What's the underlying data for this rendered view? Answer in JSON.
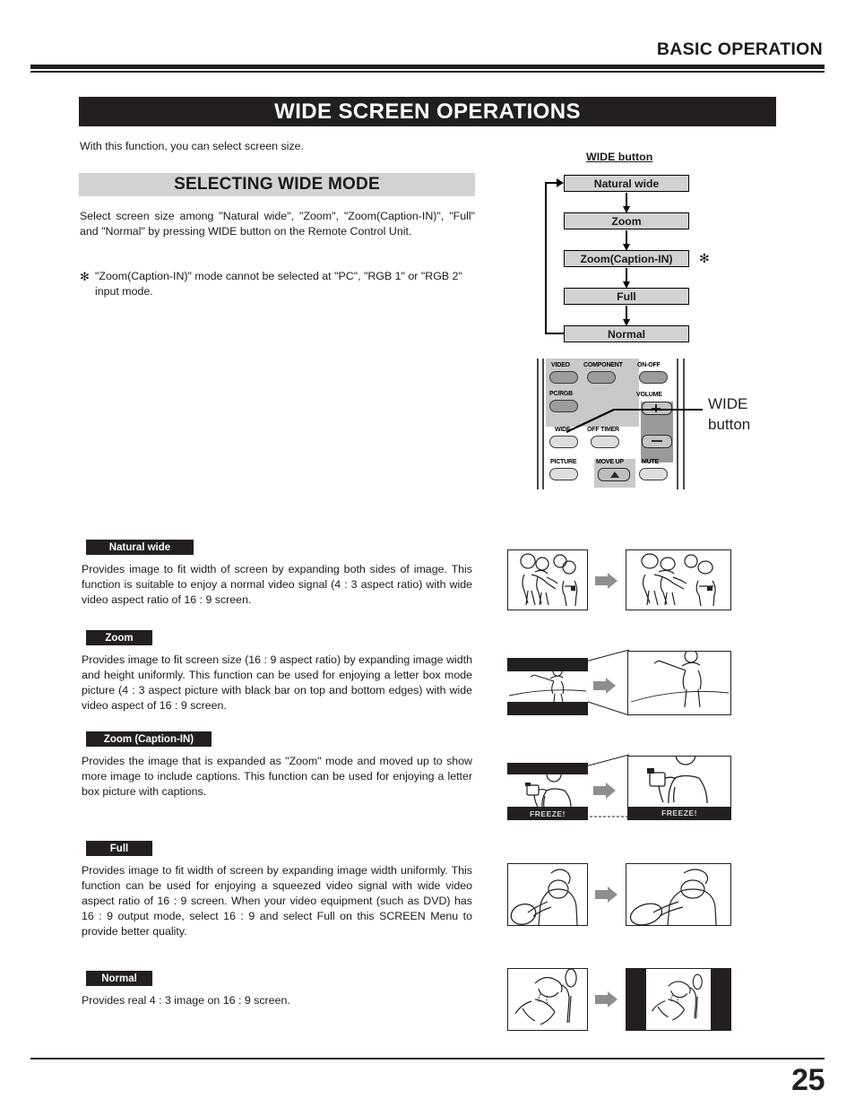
{
  "header": {
    "title": "BASIC OPERATION"
  },
  "banner": {
    "title": "WIDE SCREEN OPERATIONS"
  },
  "intro": {
    "text": "With this function, you can select screen size."
  },
  "subsection": {
    "title": "SELECTING WIDE MODE",
    "paragraph": "Select screen size among \"Natural wide\", \"Zoom\", \"Zoom(Caption-IN)\", \"Full\" and \"Normal\" by pressing WIDE button on the Remote Control Unit.",
    "note_mark": "✻",
    "note": "\"Zoom(Caption-IN)\" mode cannot be selected at \"PC\", \"RGB 1\" or \"RGB 2\" input mode."
  },
  "flow": {
    "caption": "WIDE button",
    "asterisk": "✻",
    "steps": [
      {
        "label": "Natural wide"
      },
      {
        "label": "Zoom"
      },
      {
        "label": "Zoom(Caption-IN)"
      },
      {
        "label": "Full"
      },
      {
        "label": "Normal"
      }
    ]
  },
  "remote": {
    "callout_line1": "WIDE",
    "callout_line2": "button",
    "buttons": [
      {
        "label": "VIDEO"
      },
      {
        "label": "COMPONENT"
      },
      {
        "label": "ON-OFF"
      },
      {
        "label": "PC/RGB"
      },
      {
        "label": "VOLUME"
      },
      {
        "label": "WIDE"
      },
      {
        "label": "OFF TIMER"
      },
      {
        "label": "PICTURE"
      },
      {
        "label": "MOVE UP"
      },
      {
        "label": "MUTE"
      }
    ]
  },
  "modes": [
    {
      "label": "Natural wide",
      "text": "Provides image to fit width of screen by expanding both sides of image.  This function is suitable to enjoy a normal video signal (4 : 3 aspect ratio) with wide video aspect ratio of 16 : 9 screen."
    },
    {
      "label": "Zoom",
      "text": "Provides image to fit screen size (16 : 9 aspect ratio) by expanding image width and height uniformly.  This function can be used for enjoying a letter box mode picture (4 : 3 aspect picture with black bar on top and bottom edges) with wide video aspect of 16 : 9 screen."
    },
    {
      "label": "Zoom (Caption-IN)",
      "text": "Provides the image that is expanded as \"Zoom\" mode and moved up to show more image to include captions. This function can be used for enjoying a letter box picture with captions.",
      "caption_before": "FREEZE!",
      "caption_after": "FREEZE!"
    },
    {
      "label": "Full",
      "text": "Provides image to fit width of screen by expanding image width uniformly.  This function can be used for enjoying a squeezed video signal with wide video aspect ratio of 16 : 9 screen.\nWhen your video equipment (such as DVD) has 16 : 9 output mode, select 16 : 9 and select Full on this SCREEN Menu to provide better quality."
    },
    {
      "label": "Normal",
      "text": "Provides real 4 : 3 image on 16 : 9 screen."
    }
  ],
  "footer": {
    "page_number": "25"
  },
  "colors": {
    "ink": "#231f20",
    "gray_bar": "#d2d2d2",
    "arrow_gray": "#8e8e8e"
  }
}
